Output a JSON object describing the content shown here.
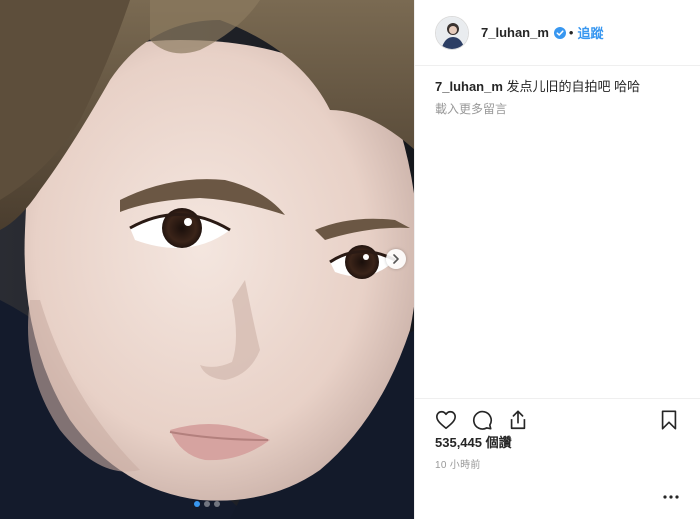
{
  "post": {
    "username": "7_luhan_m",
    "separator": "•",
    "follow_label": "追蹤",
    "caption_user": "7_luhan_m",
    "caption_text": "发点儿旧的自拍吧 哈哈",
    "load_more_label": "載入更多留言",
    "likes": "535,445 個讚",
    "time_ago": "10 小時前"
  },
  "carousel": {
    "total_slides": 3,
    "active_index": 0
  },
  "icons": {
    "verified": "verified-badge-icon",
    "next": "chevron-right-icon",
    "like": "heart-outline-icon",
    "comment": "comment-bubble-icon",
    "share": "share-upload-icon",
    "save": "bookmark-outline-icon",
    "more": "more-options-icon"
  },
  "colors": {
    "accent": "#3897f0",
    "text": "#262626",
    "muted": "#999999",
    "divider": "#efefef"
  }
}
